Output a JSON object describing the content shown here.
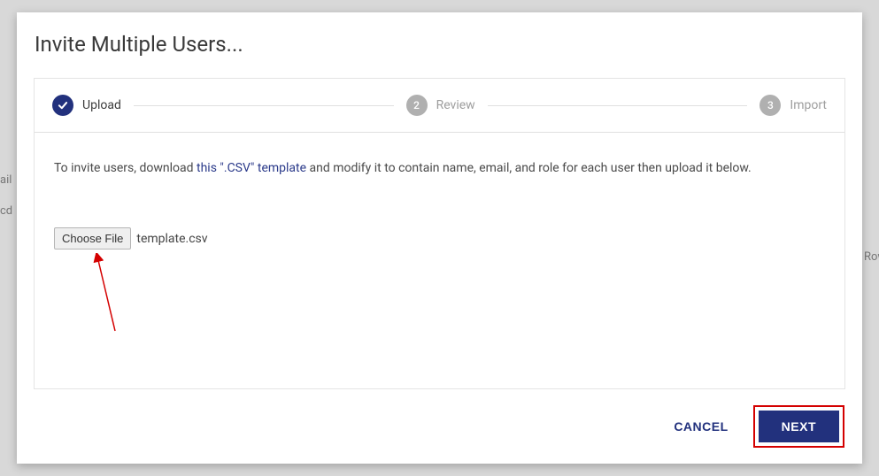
{
  "background": {
    "frag1": "ail",
    "frag2": "cd",
    "frag3": "Row"
  },
  "dialog": {
    "title": "Invite Multiple Users..."
  },
  "stepper": {
    "step1": {
      "label": "Upload"
    },
    "step2": {
      "num": "2",
      "label": "Review"
    },
    "step3": {
      "num": "3",
      "label": "Import"
    }
  },
  "instruction": {
    "pre": "To invite users, download ",
    "link": "this \".CSV\" template",
    "post": " and modify it to contain name, email, and role for each user then upload it below."
  },
  "file": {
    "button": "Choose File",
    "name": "template.csv"
  },
  "actions": {
    "cancel": "CANCEL",
    "next": "NEXT"
  }
}
